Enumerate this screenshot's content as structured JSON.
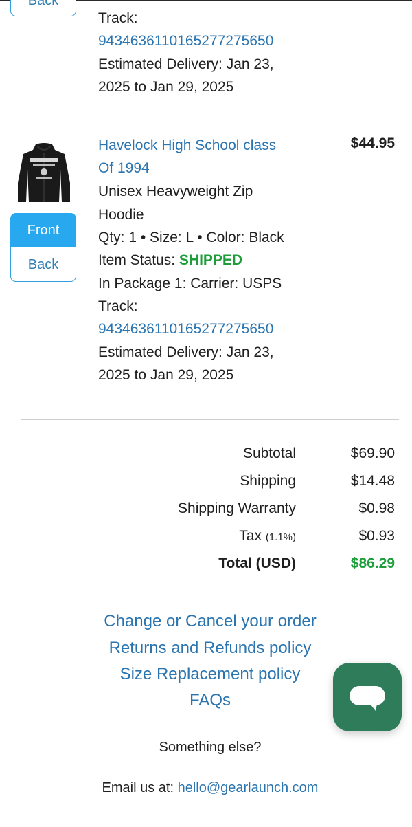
{
  "previous_item": {
    "back_label": "Back",
    "track_label": "Track:",
    "tracking_number": "9434636110165277275650",
    "estimated_delivery_1": "Estimated Delivery: Jan 23,",
    "estimated_delivery_2": "2025 to Jan 29, 2025"
  },
  "item": {
    "title_line1": "Havelock High School class",
    "title_line2": "Of 1994",
    "price": "$44.95",
    "product_line1": "Unisex Heavyweight Zip",
    "product_line2": "Hoodie",
    "qty_size_color": "Qty: 1 • Size: L • Color: Black",
    "status_label": "Item Status: ",
    "status_value": "SHIPPED",
    "package_info": "In Package 1: Carrier: USPS",
    "track_label": "Track:",
    "tracking_number": "9434636110165277275650",
    "estimated_delivery_1": "Estimated Delivery: Jan 23,",
    "estimated_delivery_2": "2025 to Jan 29, 2025",
    "front_label": "Front",
    "back_label": "Back",
    "thumbnail_icon": "black-hoodie-image"
  },
  "summary": {
    "subtotal_label": "Subtotal",
    "subtotal_value": "$69.90",
    "shipping_label": "Shipping",
    "shipping_value": "$14.48",
    "warranty_label": "Shipping Warranty",
    "warranty_value": "$0.98",
    "tax_label": "Tax",
    "tax_rate": "(1.1%)",
    "tax_value": "$0.93",
    "total_label": "Total (USD)",
    "total_value": "$86.29",
    "total_color": "#1e9e3a"
  },
  "links": {
    "change_cancel": "Change or Cancel your order",
    "returns": "Returns and Refunds policy",
    "size_replacement": "Size Replacement policy",
    "faqs": "FAQs"
  },
  "contact": {
    "something_else": "Something else?",
    "email_prefix": "Email us at: ",
    "email": "hello@gearlaunch.com"
  },
  "chat": {
    "icon": "chat-bubble-icon",
    "color": "#2f7c5a"
  }
}
